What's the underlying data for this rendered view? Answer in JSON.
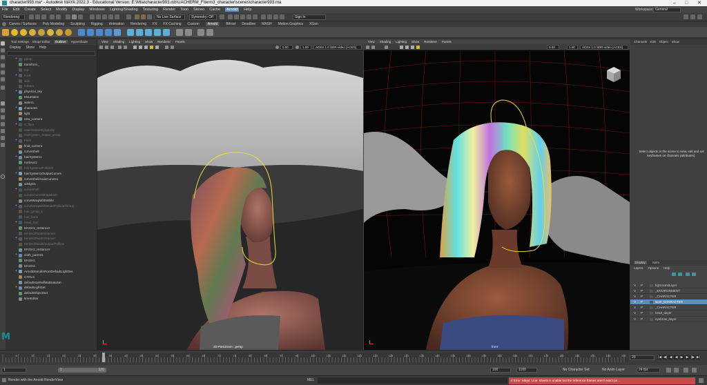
{
  "window": {
    "title": "character993.ma* - Autodesk MAYA 2022.3 - Educational Version: E:\\Mila\\character993.mb\\UACHERM_F\\term3_character\\scenes\\character993.ma",
    "workspace_label": "Workspace:",
    "workspace_value": "General"
  },
  "menubar": {
    "items": [
      "File",
      "Edit",
      "Create",
      "Select",
      "Modify",
      "Display",
      "Windows",
      "Lighting/Shading",
      "Texturing",
      "Render",
      "Toon",
      "Stereo",
      "Cache",
      "Arnold",
      "Help"
    ],
    "active": "Arnold"
  },
  "statusline": {
    "mode": "Rendering",
    "no_live_surface": "No Live Surface",
    "symmetry": "Symmetry: Off",
    "sign_in": "Sign In"
  },
  "shelf_tabs": [
    "Curves / Surfaces",
    "Poly Modeling",
    "Sculpting",
    "Rigging",
    "Animation",
    "Rendering",
    "FX",
    "FX Caching",
    "Custom",
    "Arnold",
    "Bifrost",
    "Deadline",
    "MASH",
    "Motion Graphics",
    "XGen"
  ],
  "shelf_active": "Arnold",
  "outliner": {
    "tabs": [
      "Tool Settings",
      "Shape Editor",
      "Outliner",
      "Hypershade"
    ],
    "active_tab": "Outliner",
    "menus": [
      "Display",
      "Show",
      "Help"
    ],
    "rows": [
      {
        "label": "persp",
        "dim": true
      },
      {
        "label": "transform_",
        "dim": false
      },
      {
        "label": "top",
        "dim": true
      },
      {
        "label": "front",
        "dim": true
      },
      {
        "label": "side",
        "dim": true
      },
      {
        "label": "bottom",
        "dim": true
      },
      {
        "label": "physical_sky",
        "dim": false
      },
      {
        "label": "Mountains",
        "dim": false
      },
      {
        "label": "water1",
        "dim": false
      },
      {
        "label": "character",
        "dim": false
      },
      {
        "label": "light",
        "dim": false
      },
      {
        "label": "new_camera",
        "dim": false
      },
      {
        "label": "rt_floor",
        "dim": true
      },
      {
        "label": "Hair/Geometry/grp/dy",
        "dim": true
      },
      {
        "label": "Hairsystem_output_group",
        "dim": true
      },
      {
        "label": "Floor",
        "dim": true
      },
      {
        "label": "final_camera",
        "dim": false
      },
      {
        "label": "curveShell",
        "dim": false
      },
      {
        "label": "hairSystem1",
        "dim": false
      },
      {
        "label": "nucleus1",
        "dim": false
      },
      {
        "label": "hairSystem1Follicles",
        "dim": true
      },
      {
        "label": "hairSystem1OutputCurves",
        "dim": false
      },
      {
        "label": "curveShellAndaCurves1",
        "dim": false
      },
      {
        "label": "aiSkyD1",
        "dim": false
      },
      {
        "label": "curveShell",
        "dim": true
      },
      {
        "label": "curvesCurveWrapMesh",
        "dim": true
      },
      {
        "label": "curveWrapWithWhile",
        "dim": false
      },
      {
        "label": "curveWrapWithMode/Follicle/Group",
        "dim": true
      },
      {
        "label": "hair_group_1",
        "dim": true
      },
      {
        "label": "hair_back",
        "dim": true
      },
      {
        "label": "head_hair",
        "dim": true
      },
      {
        "label": "MASH1_Instancer",
        "dim": false
      },
      {
        "label": "MASH2PaintInstancer",
        "dim": true
      },
      {
        "label": "MASH3PaintInstancer",
        "dim": true
      },
      {
        "label": "MASH3/Waist/output/Follicle",
        "dim": true
      },
      {
        "label": "MASH2_Instancer",
        "dim": false
      },
      {
        "label": "cloth_parent1",
        "dim": false
      },
      {
        "label": "MASH1",
        "dim": false
      },
      {
        "label": "MASH3",
        "dim": false
      },
      {
        "label": "ArnoldStandInRootDefaultLightSet",
        "dim": false
      },
      {
        "label": "CTRLS",
        "dim": false
      },
      {
        "label": "defaultHairRefMatDataSet",
        "dim": false
      },
      {
        "label": "defaultLightSet",
        "dim": false
      },
      {
        "label": "defaultObjectSet",
        "dim": false
      },
      {
        "label": "timeEditor",
        "dim": false
      }
    ]
  },
  "viewport_left": {
    "menus": [
      "View",
      "Shading",
      "Lighting",
      "Show",
      "Renderer",
      "Panels"
    ],
    "field1": "0.00",
    "field2": "1.00",
    "color_mgmt": "ACES 1.0 SDR-video (ACES)",
    "camera_label": "2D Pan/Zoom : persp"
  },
  "viewport_right": {
    "menus": [
      "View",
      "Shading",
      "Lighting",
      "Show",
      "Renderer",
      "Panels"
    ],
    "field1": "0.00",
    "field2": "1.00",
    "color_mgmt": "ACES 1.0 SDR-video (ACES)",
    "camera_label": "front"
  },
  "channelbox": {
    "tabs": [
      "Channels",
      "Edit",
      "Object",
      "Show"
    ],
    "message": "Select objects in the scene to view, edit and set keyframes on channels (attributes)."
  },
  "layers": {
    "tabs": [
      "Display",
      "Anim"
    ],
    "menus": [
      "Layers",
      "Options",
      "Help"
    ],
    "rows": [
      {
        "v": "V",
        "p": "P",
        "name": "bgGroundLayer",
        "selected": false
      },
      {
        "v": "V",
        "p": "P",
        "name": "_ENVIRONMENT",
        "selected": false
      },
      {
        "v": "V",
        "p": "P",
        "name": "_CHARACTER",
        "selected": false
      },
      {
        "v": "V",
        "p": "P",
        "name": "wom_CHARACTER",
        "selected": true
      },
      {
        "v": "V",
        "p": "P",
        "name": "_CHARACTER",
        "selected": false
      },
      {
        "v": "V",
        "p": "P",
        "name": "head_dayer",
        "selected": false
      },
      {
        "v": "V",
        "p": "P",
        "name": "eyebrow_dayer",
        "selected": false
      }
    ]
  },
  "timeline": {
    "ticks": [
      "5",
      "10",
      "15",
      "20",
      "25",
      "30",
      "35",
      "40",
      "45",
      "50",
      "55",
      "60",
      "65",
      "70",
      "75",
      "80",
      "85",
      "90",
      "95",
      "100",
      "105",
      "110",
      "115",
      "120",
      "125",
      "130",
      "135",
      "140",
      "145",
      "150",
      "155",
      "160",
      "165",
      "170",
      "175",
      "180",
      "185",
      "190",
      "195",
      "200"
    ],
    "current_frame": "20"
  },
  "range": {
    "start": "1",
    "inner_start": "1",
    "inner_end": "120",
    "end_a": "100",
    "end_b": "1180",
    "character_set": "No Character Set",
    "anim_layer": "No Anim Layer",
    "fps": "24 fps"
  },
  "commandline": {
    "status": "Render with the Arnold RenderView",
    "mel": "MEL",
    "error": "// Error: Maya: Line: sheets is unable but the reference frames aren't exact pe..."
  },
  "colors": {
    "accent": "#5a8fbf",
    "error_bg": "#c84a4a",
    "gizmo_yellow": "#e8e038",
    "grid_red": "#7a1818"
  }
}
